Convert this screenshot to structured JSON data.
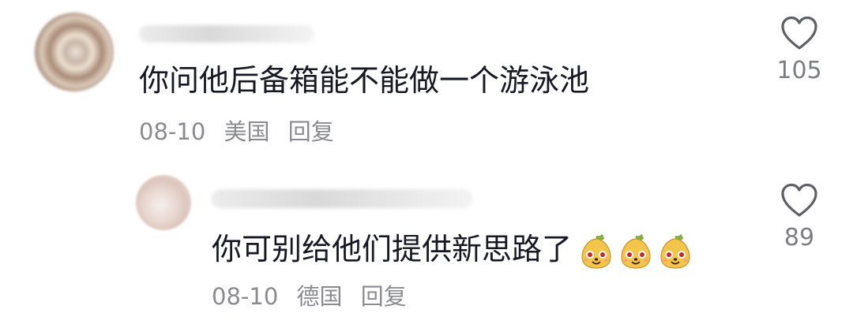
{
  "comments": [
    {
      "text": "你问他后备箱能不能做一个游泳池",
      "date": "08-10",
      "location": "美国",
      "reply_label": "回复",
      "likes": "105"
    },
    {
      "text": "你可别给他们提供新思路了",
      "emoji": [
        "laughing-pear-emoji",
        "laughing-pear-emoji",
        "laughing-pear-emoji"
      ],
      "date": "08-10",
      "location": "德国",
      "reply_label": "回复",
      "likes": "89"
    }
  ],
  "colors": {
    "text": "#161823",
    "meta": "#8a8b91",
    "like_icon": "#5f6068"
  }
}
